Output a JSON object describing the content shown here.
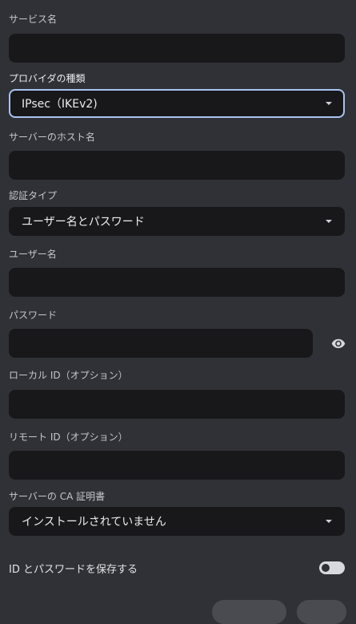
{
  "form": {
    "service_name": {
      "label": "サービス名",
      "value": ""
    },
    "provider_type": {
      "label": "プロバイダの種類",
      "value": "IPsec（IKEv2)"
    },
    "server_host": {
      "label": "サーバーのホスト名",
      "value": ""
    },
    "auth_type": {
      "label": "認証タイプ",
      "value": "ユーザー名とパスワード"
    },
    "username": {
      "label": "ユーザー名",
      "value": ""
    },
    "password": {
      "label": "パスワード",
      "value": ""
    },
    "local_id": {
      "label": "ローカル ID（オプション）",
      "value": ""
    },
    "remote_id": {
      "label": "リモート ID（オプション）",
      "value": ""
    },
    "ca_cert": {
      "label": "サーバーの CA 証明書",
      "value": "インストールされていません"
    },
    "save_credentials": {
      "label": "ID とパスワードを保存する",
      "checked": false
    }
  },
  "icons": {
    "show_password": "eye-icon",
    "dropdown": "caret-down-icon"
  },
  "colors": {
    "background": "#303136",
    "field": "#18181b",
    "focus_border": "#a8c4f0"
  }
}
